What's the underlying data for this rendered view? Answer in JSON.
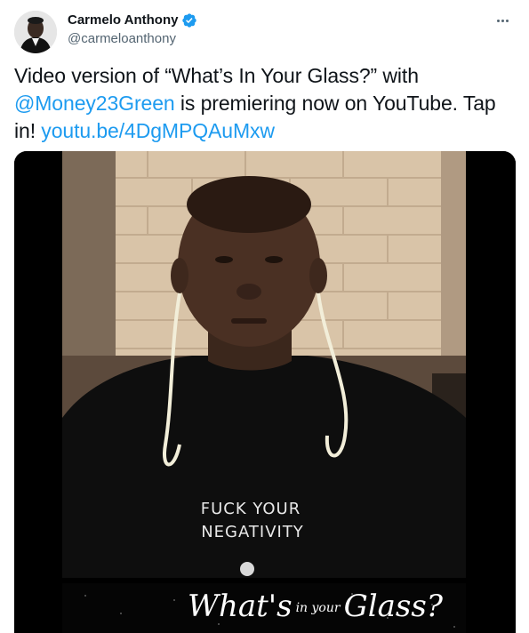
{
  "author": {
    "display_name": "Carmelo Anthony",
    "handle": "@carmeloanthony",
    "verified": true,
    "avatar_icon": "profile-photo",
    "verified_icon": "verified-badge-icon"
  },
  "tweet": {
    "text_part1": "Video version of “What’s In Your Glass?” with ",
    "mention": "@Money23Green",
    "text_part2": " is premiering now on YouTube. Tap in! ",
    "link": "youtu.be/4DgMPQAuMxw"
  },
  "media": {
    "shirt_line1": "FUCK YOUR",
    "shirt_line2": "NEGATIVITY",
    "overlay_title_part1": "What's",
    "overlay_title_small": "in your",
    "overlay_title_part2": "Glass?"
  },
  "colors": {
    "link": "#1d9bf0",
    "text": "#0f1419",
    "secondary": "#536471",
    "verified": "#1d9bf0"
  }
}
